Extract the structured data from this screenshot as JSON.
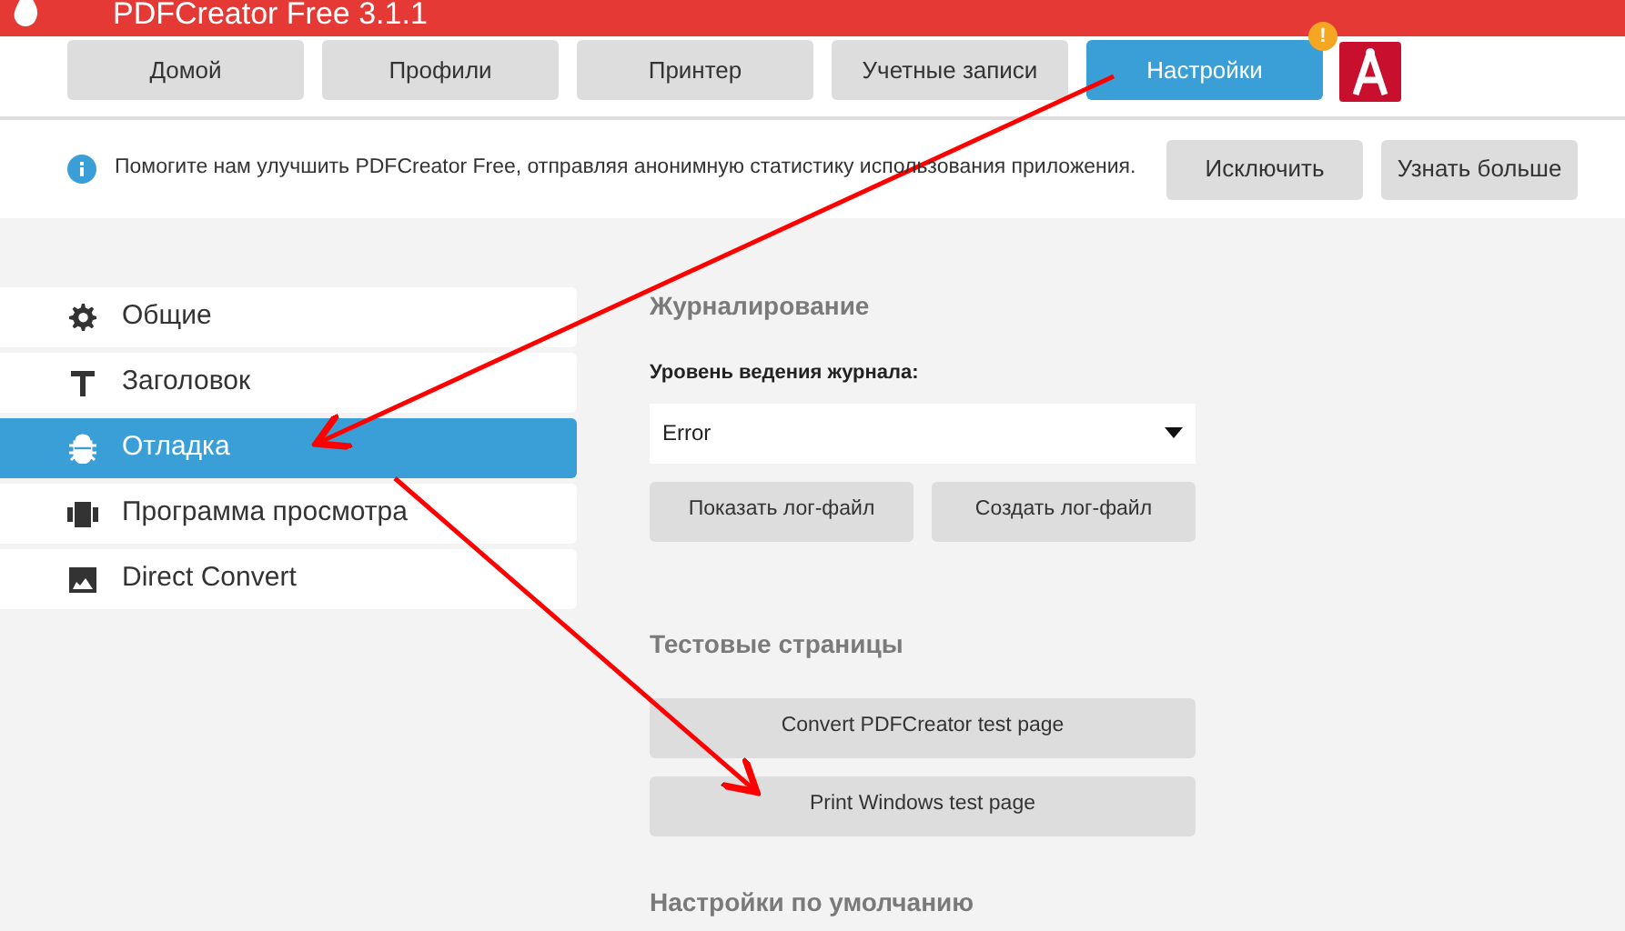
{
  "window": {
    "title": "PDFCreator Free 3.1.1"
  },
  "tabs": [
    {
      "label": "Домой",
      "selected": false
    },
    {
      "label": "Профили",
      "selected": false
    },
    {
      "label": "Принтер",
      "selected": false
    },
    {
      "label": "Учетные записи",
      "selected": false
    },
    {
      "label": "Настройки",
      "selected": true,
      "badge": "!"
    }
  ],
  "info_bar": {
    "message": "Помогите нам улучшить PDFCreator Free, отправляя анонимную статистику использования приложения.",
    "buttons": [
      "Исключить",
      "Узнать больше"
    ]
  },
  "sidebar": {
    "items": [
      {
        "label": "Общие",
        "kind": "gear",
        "selected": false
      },
      {
        "label": "Заголовок",
        "kind": "title",
        "selected": false
      },
      {
        "label": "Отладка",
        "kind": "bug",
        "selected": true
      },
      {
        "label": "Программа просмотра",
        "kind": "viewer",
        "selected": false
      },
      {
        "label": "Direct Convert",
        "kind": "image",
        "selected": false
      }
    ]
  },
  "content": {
    "logging": {
      "heading": "Журналирование",
      "level_label": "Уровень ведения журнала:",
      "level_value": "Error",
      "buttons": [
        "Показать лог-файл",
        "Создать лог-файл"
      ]
    },
    "test_pages": {
      "heading": "Тестовые страницы",
      "buttons": [
        "Convert PDFCreator test page",
        "Print Windows test page"
      ]
    },
    "defaults": {
      "heading": "Настройки по умолчанию"
    }
  }
}
